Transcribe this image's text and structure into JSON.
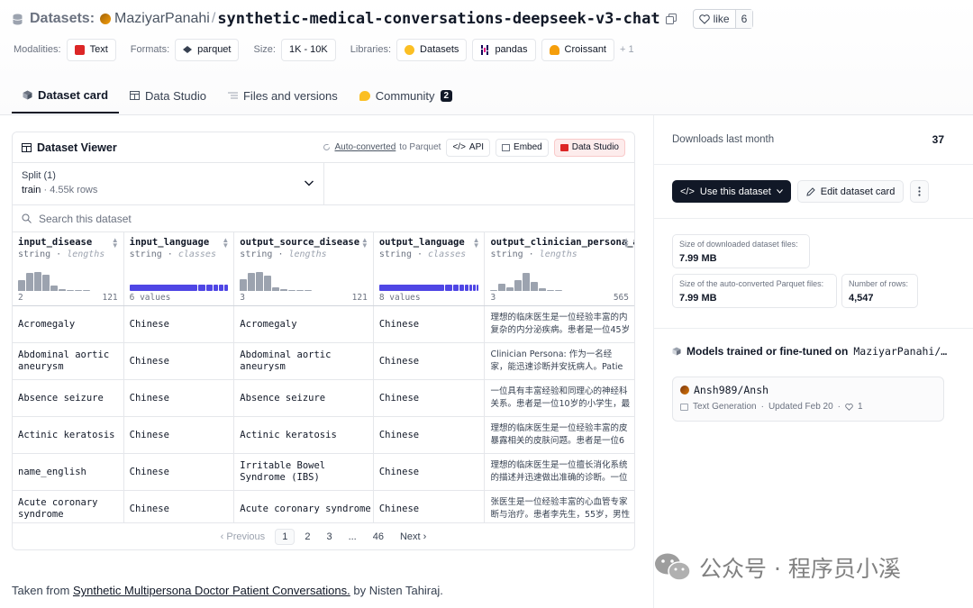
{
  "header": {
    "section_label": "Datasets:",
    "owner": "MaziyarPanahi",
    "separator": "/",
    "repo": "synthetic-medical-conversations-deepseek-v3-chat",
    "like_label": "like",
    "like_count": "6"
  },
  "meta": {
    "modalities_label": "Modalities:",
    "modality": "Text",
    "formats_label": "Formats:",
    "format": "parquet",
    "size_label": "Size:",
    "size": "1K - 10K",
    "libraries_label": "Libraries:",
    "libraries": [
      "Datasets",
      "pandas",
      "Croissant"
    ],
    "more_libraries": "+ 1"
  },
  "tabs": [
    {
      "label": "Dataset card"
    },
    {
      "label": "Data Studio"
    },
    {
      "label": "Files and versions"
    },
    {
      "label": "Community",
      "count": "2"
    }
  ],
  "viewer": {
    "title": "Dataset Viewer",
    "auto_converted_a": "Auto-converted",
    "auto_converted_b": "to Parquet",
    "api": "API",
    "embed": "Embed",
    "data_studio": "Data Studio",
    "split_label": "Split (1)",
    "split_name": "train",
    "split_rows": "· 4.55k rows",
    "search_placeholder": "Search this dataset",
    "columns": [
      {
        "name": "input_disease",
        "type": "string",
        "stat": "lengths",
        "kind": "hist",
        "min": "2",
        "max": "121",
        "hist": [
          0.55,
          0.9,
          0.95,
          0.8,
          0.25,
          0.1,
          0.05,
          0.05,
          0.05
        ]
      },
      {
        "name": "input_language",
        "type": "string",
        "stat": "classes",
        "kind": "classes",
        "summary": "6 values",
        "class_weights": [
          0.72,
          0.08,
          0.06,
          0.05,
          0.05,
          0.04
        ]
      },
      {
        "name": "output_source_disease",
        "type": "string",
        "stat": "lengths",
        "kind": "hist",
        "min": "3",
        "max": "121",
        "hist": [
          0.6,
          0.9,
          0.95,
          0.75,
          0.2,
          0.08,
          0.05,
          0.05,
          0.05
        ]
      },
      {
        "name": "output_language",
        "type": "string",
        "stat": "classes",
        "kind": "classes",
        "summary": "8 values",
        "class_weights": [
          0.7,
          0.07,
          0.06,
          0.05,
          0.04,
          0.03,
          0.03,
          0.02
        ]
      },
      {
        "name": "output_clinician_persona_a",
        "type": "string",
        "stat": "lengths",
        "kind": "hist",
        "min": "3",
        "max": "565",
        "hist": [
          0.05,
          0.35,
          0.2,
          0.55,
          0.9,
          0.45,
          0.15,
          0.05,
          0.05
        ]
      }
    ],
    "rows": [
      [
        "Acromegaly",
        "Chinese",
        "Acromegaly",
        "Chinese",
        "理想的临床医生是一位经验丰富的内\n复杂的内分泌疾病。患者是一位45岁"
      ],
      [
        "Abdominal aortic\naneurysm",
        "Chinese",
        "Abdominal aortic\naneurysm",
        "Chinese",
        "Clinician Persona: 作为一名经\n家，能迅速诊断并安抚病人。Patie"
      ],
      [
        "Absence seizure",
        "Chinese",
        "Absence seizure",
        "Chinese",
        "一位具有丰富经验和同理心的神经科\n关系。患者是一位10岁的小学生，最"
      ],
      [
        "Actinic keratosis",
        "Chinese",
        "Actinic keratosis",
        "Chinese",
        "理想的临床医生是一位经验丰富的皮\n暴露相关的皮肤问题。患者是一位6"
      ],
      [
        "name_english",
        "Chinese",
        "Irritable Bowel\nSyndrome (IBS)",
        "Chinese",
        "理想的临床医生是一位擅长消化系统\n的描述并迅速做出准确的诊断。一位"
      ],
      [
        "Acute coronary\nsyndrome",
        "Chinese",
        "Acute coronary syndrome",
        "Chinese",
        "张医生是一位经验丰富的心血管专家\n断与治疗。患者李先生，55岁，男性"
      ]
    ],
    "pager": {
      "prev": "‹ Previous",
      "pages": [
        "1",
        "2",
        "3",
        "...",
        "46"
      ],
      "next": "Next ›"
    }
  },
  "sidebar": {
    "downloads_label": "Downloads last month",
    "downloads_value": "37",
    "use_dataset": "Use this dataset",
    "edit_card": "Edit dataset card",
    "stats": [
      {
        "label": "Size of downloaded dataset files:",
        "value": "7.99 MB"
      },
      {
        "label": "Size of the auto-converted Parquet files:",
        "value": "7.99 MB"
      },
      {
        "label": "Number of rows:",
        "value": "4,547"
      }
    ],
    "models_title": "Models trained or fine-tuned on",
    "models_owner": "MaziyarPanahi/…",
    "model": {
      "name": "Ansh989/Ansh",
      "task": "Text Generation",
      "updated": "Updated Feb 20",
      "likes": "1",
      "dot": "·"
    }
  },
  "footnote": {
    "prefix": "Taken from",
    "link": "Synthetic Multipersona Doctor Patient Conversations.",
    "suffix": "by Nisten Tahiraj."
  },
  "watermark": {
    "text": "公众号 · 程序员小溪"
  },
  "colors": {
    "accent_indigo": "#4f46e5",
    "dark_button": "#111827",
    "hist_bar": "#9ca3af"
  }
}
